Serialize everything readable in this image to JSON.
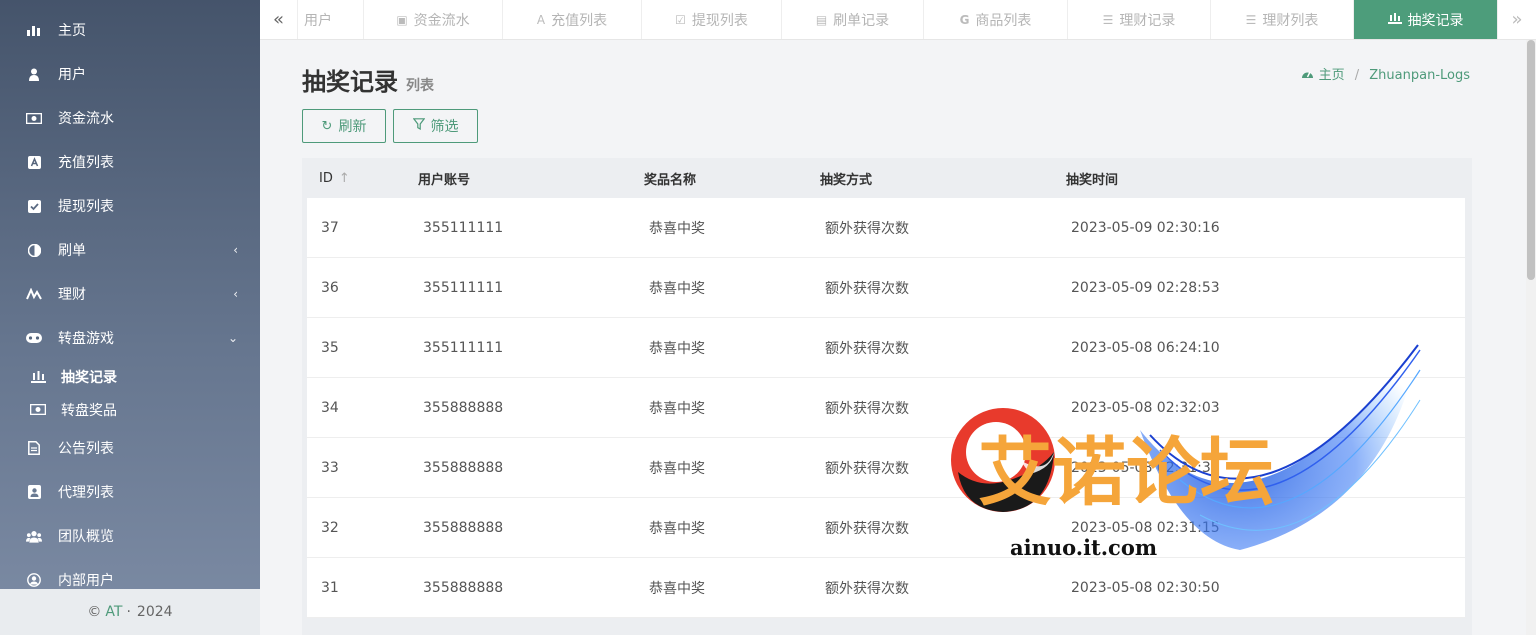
{
  "sidebar": {
    "items": [
      {
        "label": "主页",
        "icon": "bar-chart-icon"
      },
      {
        "label": "用户",
        "icon": "user-icon"
      },
      {
        "label": "资金流水",
        "icon": "money-icon"
      },
      {
        "label": "充值列表",
        "icon": "font-icon"
      },
      {
        "label": "提现列表",
        "icon": "check-square-icon"
      },
      {
        "label": "刷单",
        "icon": "adjust-icon",
        "expandable": true
      },
      {
        "label": "理财",
        "icon": "finance-icon",
        "expandable": true
      },
      {
        "label": "转盘游戏",
        "icon": "gamepad-icon",
        "expanded": true
      }
    ],
    "sub_items": [
      {
        "label": "抽奖记录",
        "icon": "podium-icon",
        "active": true
      },
      {
        "label": "转盘奖品",
        "icon": "money-icon"
      }
    ],
    "items_after": [
      {
        "label": "公告列表",
        "icon": "file-icon"
      },
      {
        "label": "代理列表",
        "icon": "id-card-icon"
      },
      {
        "label": "团队概览",
        "icon": "users-icon"
      },
      {
        "label": "内部用户",
        "icon": "user-circle-icon"
      }
    ],
    "footer": {
      "copyright": "©",
      "brand": "AT",
      "dot": "·",
      "year": "2024"
    }
  },
  "tabs": [
    {
      "label": "用户",
      "icon": "user-icon"
    },
    {
      "label": "资金流水",
      "icon": "money-icon"
    },
    {
      "label": "充值列表",
      "icon": "font-icon"
    },
    {
      "label": "提现列表",
      "icon": "check-square-icon"
    },
    {
      "label": "刷单记录",
      "icon": "keyboard-icon"
    },
    {
      "label": "商品列表",
      "icon": "google-icon"
    },
    {
      "label": "理财记录",
      "icon": "list-icon"
    },
    {
      "label": "理财列表",
      "icon": "list-alt-icon"
    },
    {
      "label": "抽奖记录",
      "icon": "podium-icon",
      "active": true
    }
  ],
  "header": {
    "title": "抽奖记录",
    "subtitle": "列表"
  },
  "breadcrumb": {
    "home": "主页",
    "sep": "/",
    "current": "Zhuanpan-Logs"
  },
  "toolbar": {
    "refresh_label": "刷新",
    "filter_label": "筛选"
  },
  "table": {
    "columns": [
      "ID",
      "用户账号",
      "奖品名称",
      "抽奖方式",
      "抽奖时间"
    ],
    "rows": [
      [
        "37",
        "355111111",
        "恭喜中奖",
        "额外获得次数",
        "2023-05-09 02:30:16"
      ],
      [
        "36",
        "355111111",
        "恭喜中奖",
        "额外获得次数",
        "2023-05-09 02:28:53"
      ],
      [
        "35",
        "355111111",
        "恭喜中奖",
        "额外获得次数",
        "2023-05-08 06:24:10"
      ],
      [
        "34",
        "355888888",
        "恭喜中奖",
        "额外获得次数",
        "2023-05-08 02:32:03"
      ],
      [
        "33",
        "355888888",
        "恭喜中奖",
        "额外获得次数",
        "2023-05-08 02:31:39"
      ],
      [
        "32",
        "355888888",
        "恭喜中奖",
        "额外获得次数",
        "2023-05-08 02:31:15"
      ],
      [
        "31",
        "355888888",
        "恭喜中奖",
        "额外获得次数",
        "2023-05-08 02:30:50"
      ]
    ]
  },
  "watermark": {
    "title": "艾诺论坛",
    "url": "ainuo.it.com"
  },
  "colors": {
    "accent": "#4d9d7b",
    "sidebar_top": "#45546b",
    "sidebar_bottom": "#7d8ca5"
  }
}
